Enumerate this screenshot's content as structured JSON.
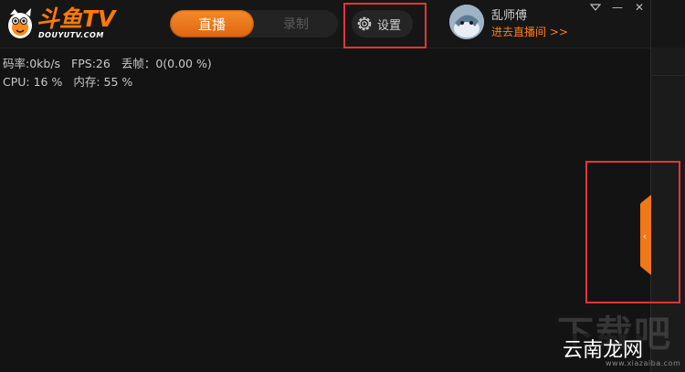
{
  "brand": {
    "logo_text": "斗鱼TV",
    "logo_url_text": "DOUYUTV.COM",
    "accent_color": "#ff7a00"
  },
  "tabs": {
    "live_label": "直播",
    "record_label": "录制"
  },
  "settings": {
    "label": "设置",
    "icon": "gear-icon"
  },
  "user": {
    "name": "乱师傅",
    "enter_room_label": "进去直播间 >>"
  },
  "window_controls": {
    "menu_icon": "dropdown-triangle-icon",
    "minimize_label": "—",
    "close_label": "✕"
  },
  "stats": {
    "bitrate": "码率:0kb/s",
    "fps": "FPS:26",
    "dropped": "丢帧：0(0.00 %)",
    "cpu": "CPU: 16 %",
    "memory": "内存: 55 %"
  },
  "side_panel": {
    "toggle_glyph": "‹"
  },
  "watermark": {
    "big": "下载吧",
    "sub": "云南龙网",
    "url": "www.xiazaiba.com"
  },
  "highlight_color": "#e53535"
}
